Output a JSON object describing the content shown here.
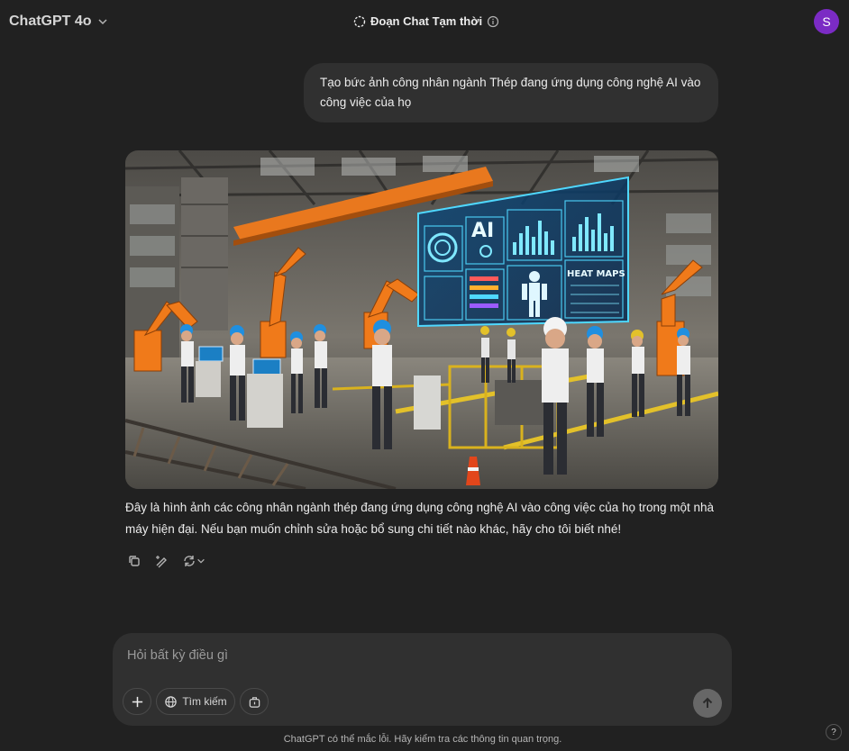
{
  "header": {
    "model_label": "ChatGPT 4o",
    "temp_chat_label": "Đoạn Chat Tạm thời",
    "avatar_initial": "S"
  },
  "conversation": {
    "user_message": "Tạo bức ảnh công nhân ngành Thép đang ứng dụng công nghệ AI vào công việc của họ",
    "image_text": {
      "ai": "AI",
      "heat_maps": "HEAT MAPS"
    },
    "assistant_reply": "Đây là hình ảnh các công nhân ngành thép đang ứng dụng công nghệ AI vào công việc của họ trong một nhà máy hiện đại. Nếu bạn muốn chỉnh sửa hoặc bổ sung chi tiết nào khác, hãy cho tôi biết nhé!"
  },
  "composer": {
    "placeholder": "Hỏi bất kỳ điều gì",
    "search_label": "Tìm kiếm"
  },
  "footer": {
    "disclaimer": "ChatGPT có thể mắc lỗi. Hãy kiểm tra các thông tin quan trọng.",
    "help_label": "?"
  },
  "colors": {
    "background": "#212121",
    "bubble": "#303030",
    "avatar": "#7b2bc4",
    "hologram": "#4fd8ff",
    "robot": "#f07a1a"
  }
}
